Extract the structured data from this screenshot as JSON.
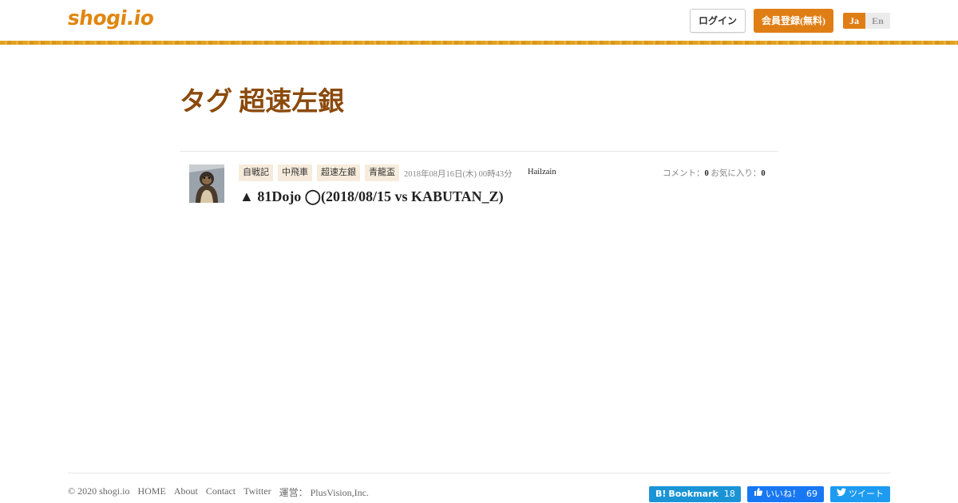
{
  "header": {
    "logo": "shogi.io",
    "login": "ログイン",
    "register": "会員登録(無料)",
    "lang_ja": "Ja",
    "lang_en": "En"
  },
  "page": {
    "title": "タグ 超速左銀"
  },
  "entries": [
    {
      "tags": [
        "自戦記",
        "中飛車",
        "超速左銀",
        "青龍盃"
      ],
      "date": "2018年08月16日(木) 00時43分",
      "user": "Hailzain",
      "comment_label": "コメント：",
      "comment_count": "0",
      "fav_label": "お気に入り：",
      "fav_count": "0",
      "title": "▲ 81Dojo ◯(2018/08/15 vs KABUTAN_Z)"
    }
  ],
  "footer": {
    "links": [
      "© 2020 shogi.io",
      "HOME",
      "About",
      "Contact",
      "Twitter",
      "運営： PlusVision,Inc."
    ],
    "hatena_label": "Bookmark",
    "hatena_count": "18",
    "fb_label": "いいね！",
    "fb_count": "69",
    "tw_label": "ツイート"
  },
  "colors": {
    "accent": "#e07e16",
    "title": "#8b4a0c",
    "tag_bg": "#f7ecdc"
  }
}
